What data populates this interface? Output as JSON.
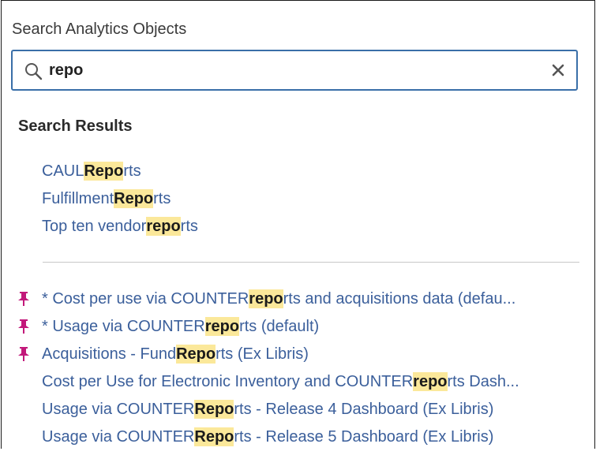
{
  "panel": {
    "title": "Search Analytics Objects",
    "search": {
      "value": "repo",
      "placeholder": ""
    },
    "results_heading": "Search Results"
  },
  "folders": [
    {
      "pre": "CAUL ",
      "match": "Repo",
      "post": "rts"
    },
    {
      "pre": "Fulfillment ",
      "match": "Repo",
      "post": "rts"
    },
    {
      "pre": "Top ten vendor ",
      "match": "repo",
      "post": "rts"
    }
  ],
  "reports": [
    {
      "pinned": true,
      "pre": "* Cost per use via COUNTER ",
      "match": "repo",
      "post": "rts and acquisitions data (defau..."
    },
    {
      "pinned": true,
      "pre": "* Usage via COUNTER ",
      "match": "repo",
      "post": "rts (default)"
    },
    {
      "pinned": true,
      "pre": "Acquisitions - Fund ",
      "match": "Repo",
      "post": "rts (Ex Libris)"
    },
    {
      "pinned": false,
      "pre": "Cost per Use for Electronic Inventory and COUNTER ",
      "match": "repo",
      "post": "rts Dash..."
    },
    {
      "pinned": false,
      "pre": "Usage via COUNTER ",
      "match": "Repo",
      "post": "rts - Release 4 Dashboard (Ex Libris)"
    },
    {
      "pinned": false,
      "pre": "Usage via COUNTER ",
      "match": "Repo",
      "post": "rts - Release 5 Dashboard (Ex Libris)"
    }
  ],
  "icons": {
    "search": "search-icon",
    "clear": "close-icon",
    "pin": "pin-icon"
  },
  "colors": {
    "link": "#3b5f9b",
    "highlight": "#fbe89a",
    "pin": "#c2187a",
    "search_border": "#3a6fa8"
  }
}
